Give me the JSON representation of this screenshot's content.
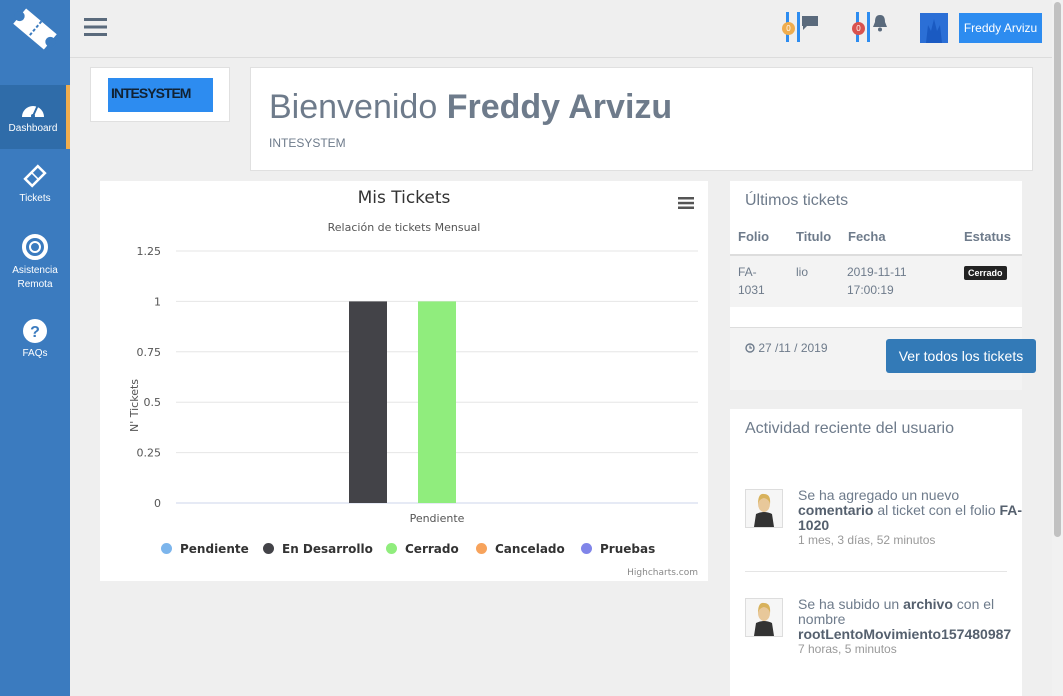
{
  "nav": {
    "items": [
      {
        "label": "Dashboard",
        "icon": "dashboard-gauge-icon"
      },
      {
        "label": "Tickets",
        "icon": "ticket-icon"
      },
      {
        "label": "Asistencia Remota",
        "icon": "lifebuoy-icon"
      },
      {
        "label": "FAQs",
        "icon": "question-circle-icon"
      }
    ]
  },
  "topbar": {
    "messages_count": "0",
    "notifications_count": "0",
    "user_name": "Freddy Arvizu"
  },
  "company": {
    "logo_text": "INTESYSTEM"
  },
  "welcome": {
    "greeting": "Bienvenido",
    "user_name": "Freddy Arvizu",
    "company": "INTESYSTEM"
  },
  "chart_data": {
    "type": "bar",
    "title": "Mis Tickets",
    "subtitle": "Relación de tickets Mensual",
    "ylabel": "N' Tickets",
    "xlabel": "",
    "categories": [
      "Pendiente"
    ],
    "ylim": [
      0,
      1.25
    ],
    "yticks": [
      "0",
      "0.25",
      "0.5",
      "0.75",
      "1",
      "1.25"
    ],
    "series": [
      {
        "name": "Pendiente",
        "values": [
          0
        ],
        "color": "#7cb5ec"
      },
      {
        "name": "En Desarrollo",
        "values": [
          1
        ],
        "color": "#434348"
      },
      {
        "name": "Cerrado",
        "values": [
          1
        ],
        "color": "#90ed7d"
      },
      {
        "name": "Cancelado",
        "values": [
          0
        ],
        "color": "#f7a35c"
      },
      {
        "name": "Pruebas",
        "values": [
          0
        ],
        "color": "#8085e9"
      }
    ],
    "legend": "bottom",
    "credit": "Highcharts.com"
  },
  "latest_tickets": {
    "title": "Últimos tickets",
    "headers": [
      "Folio",
      "Titulo",
      "Fecha",
      "Estatus"
    ],
    "rows": [
      {
        "folio_a": "FA-",
        "folio_b": "1031",
        "titulo": "lio",
        "fecha_a": "2019-11-11",
        "fecha_b": "17:00:19",
        "estatus": "Cerrado"
      }
    ],
    "date": "27 /11 / 2019",
    "view_all": "Ver todos los tickets"
  },
  "activity": {
    "title": "Actividad reciente del usuario",
    "items": [
      {
        "pre": "Se ha agregado un nuevo ",
        "bold1": "comentario",
        "mid": " al ticket con el folio ",
        "bold2": "FA-1020",
        "time": "1 mes, 3 días, 52 minutos"
      },
      {
        "pre": "Se ha subido un ",
        "bold1": "archivo",
        "mid": " con el nombre ",
        "bold2": "rootLentoMovimiento157480987",
        "time": "7 horas, 5 minutos"
      }
    ]
  }
}
